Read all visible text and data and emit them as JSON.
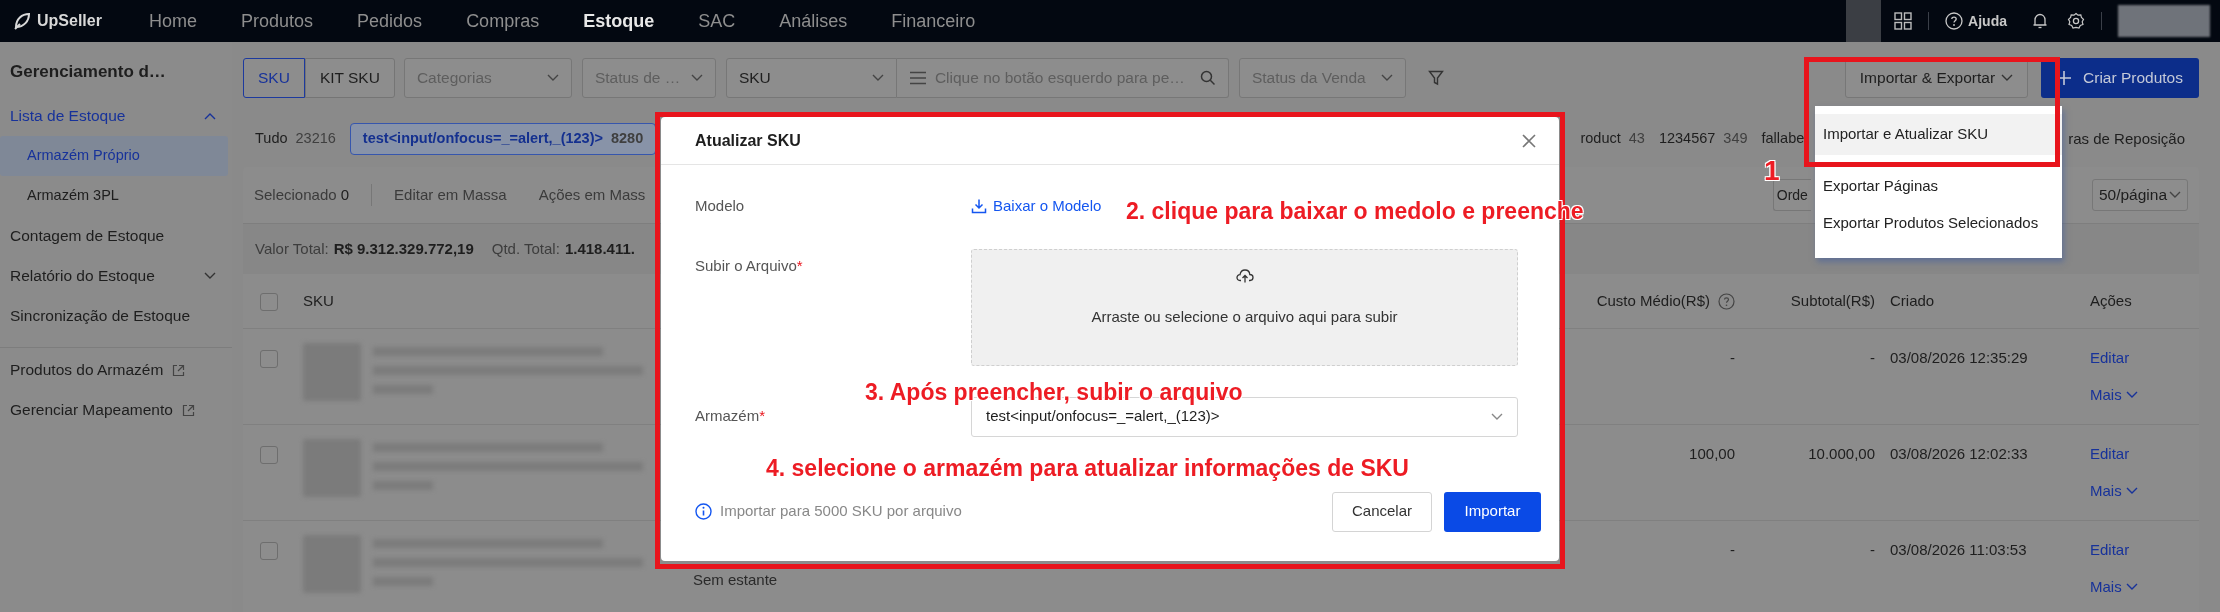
{
  "top_nav": {
    "logo": "UpSeller",
    "items": [
      {
        "label": "Home",
        "selected": false
      },
      {
        "label": "Produtos",
        "selected": false
      },
      {
        "label": "Pedidos",
        "selected": false
      },
      {
        "label": "Compras",
        "selected": false
      },
      {
        "label": "Estoque",
        "selected": true
      },
      {
        "label": "SAC",
        "selected": false
      },
      {
        "label": "Análises",
        "selected": false
      },
      {
        "label": "Financeiro",
        "selected": false
      }
    ],
    "help": "Ajuda"
  },
  "sidebar": {
    "title": "Gerenciamento d…",
    "items": [
      {
        "label": "Lista de Estoque",
        "active": true,
        "expanded": true,
        "children": [
          {
            "label": "Armazém Próprio",
            "selected": true
          },
          {
            "label": "Armazém 3PL",
            "selected": false
          }
        ]
      },
      {
        "label": "Contagem de Estoque",
        "active": false
      },
      {
        "label": "Relatório do Estoque",
        "active": false,
        "expanded": false
      },
      {
        "label": "Sincronização de Estoque",
        "active": false
      }
    ],
    "external_links": [
      {
        "label": "Produtos do Armazém"
      },
      {
        "label": "Gerenciar Mapeamento"
      }
    ]
  },
  "filter_bar": {
    "type_tabs": [
      {
        "label": "SKU",
        "selected": true
      },
      {
        "label": "KIT SKU",
        "selected": false
      }
    ],
    "filters": [
      {
        "kind": "select",
        "placeholder": "Categorias"
      },
      {
        "kind": "select",
        "placeholder": "Status de …"
      },
      {
        "kind": "select",
        "value": "SKU"
      },
      {
        "kind": "search",
        "placeholder": "Clique no botão esquerdo para pe…"
      },
      {
        "kind": "select",
        "placeholder": "Status da Venda"
      }
    ],
    "import_export": "Importar & Exportar",
    "create": "Criar Produtos"
  },
  "import_menu": {
    "items": [
      {
        "label": "Importar e Atualizar SKU",
        "selected": true
      },
      {
        "label": "Exportar Páginas",
        "selected": false
      },
      {
        "label": "Exportar Produtos Selecionados",
        "selected": false
      }
    ]
  },
  "warehouse_tabs": [
    {
      "label": "Tudo",
      "count": "23216",
      "selected": false
    },
    {
      "label": "test<input/onfocus=_=alert,_(123)>",
      "count": "8280",
      "selected": true
    },
    {
      "label": "roduct",
      "count": "43",
      "selected": false
    },
    {
      "label": "1234567",
      "count": "349",
      "selected": false
    },
    {
      "label": "fallabe",
      "selected": false
    }
  ],
  "replenishment_link": "ras de Reposição",
  "toolbar": {
    "selected_label": "Selecionado",
    "selected_count": "0",
    "actions": [
      "Editar em Massa",
      "Ações em Mass"
    ],
    "sort": "Orde",
    "page_size": "50/página"
  },
  "summary": [
    {
      "label": "Valor Total:",
      "value": "R$ 9.312.329.772,19"
    },
    {
      "label": "Qtd. Total:",
      "value": "1.418.411."
    }
  ],
  "table": {
    "header_checked": false,
    "columns": [
      {
        "label": "SKU",
        "help": false
      },
      {
        "label": "Custo Médio(R$)",
        "help": true
      },
      {
        "label": "Subtotal(R$)",
        "help": false
      },
      {
        "label": "Criado",
        "help": false
      },
      {
        "label": "Ações",
        "help": false
      }
    ],
    "rows": [
      {
        "checked": false,
        "cost": "-",
        "subtotal": "-",
        "created": "03/08/2026 12:35:29",
        "actions": [
          "Editar",
          "Mais"
        ]
      },
      {
        "checked": false,
        "cost": "100,00",
        "subtotal": "10.000,00",
        "created": "03/08/2026 12:02:33",
        "actions": [
          "Editar",
          "Mais"
        ]
      },
      {
        "checked": false,
        "column_3": "Sem estante",
        "cost": "-",
        "subtotal": "-",
        "created": "03/08/2026 11:03:53",
        "actions": [
          "Editar",
          "Mais"
        ]
      }
    ]
  },
  "modal": {
    "title": "Atualizar SKU",
    "fields": [
      {
        "kind": "link",
        "label": "Modelo",
        "link": "Baixar o Modelo"
      },
      {
        "kind": "upload",
        "label": "Subir o Arquivo",
        "required_mark": "*",
        "hint": "Arraste ou selecione o arquivo aqui para subir"
      },
      {
        "kind": "select",
        "label": "Armazém",
        "required_mark": "*",
        "value": "test<input/onfocus=_=alert,_(123)>"
      }
    ],
    "info": "Importar para 5000 SKU por arquivo",
    "buttons": [
      {
        "label": "Cancelar",
        "primary": false
      },
      {
        "label": "Importar",
        "primary": true
      }
    ]
  },
  "annotations": [
    {
      "text": "1"
    },
    {
      "text": "2. clique para baixar o medolo e preenche"
    },
    {
      "text": "3. Após preencher, subir o arquivo"
    },
    {
      "text": "4. selecione o armazém para atualizar informações de SKU"
    }
  ]
}
